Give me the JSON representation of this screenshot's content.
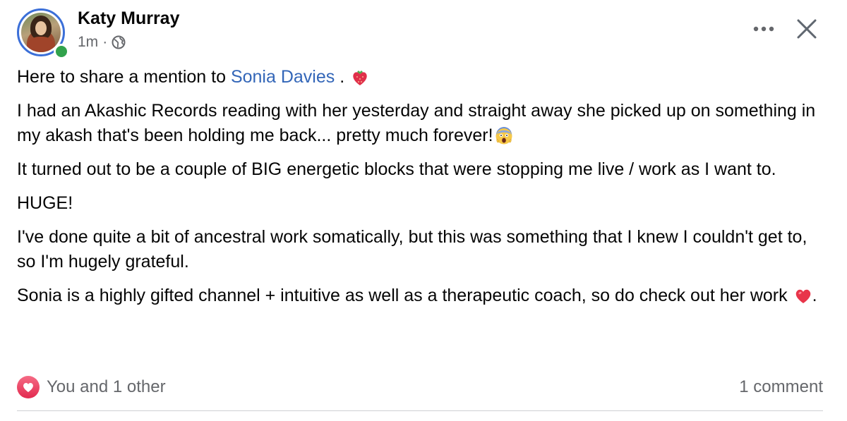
{
  "author": {
    "name": "Katy Murray",
    "time": "1m",
    "separator": "·",
    "status_color": "#31a24c"
  },
  "icons": {
    "globe": "globe-icon",
    "more": "more-options-icon",
    "close": "close-icon",
    "strawberry": "strawberry-heart-emoji",
    "scream": "face-screaming-emoji",
    "heart": "red-heart-emoji",
    "love": "love-reaction-icon"
  },
  "post": {
    "p1_before": "Here to share a mention to ",
    "p1_mention": "Sonia Davies",
    "p1_after": " . ",
    "p2": "I had an Akashic Records reading with her yesterday and straight away she picked up on something in my akash that's been holding me back... pretty much forever!",
    "p3": "It turned out to be a couple of BIG energetic blocks that were stopping me live / work as I want to.",
    "p4": "HUGE!",
    "p5": "I've done quite a bit of ancestral work somatically, but this was something that I knew I couldn't get to, so I'm hugely grateful.",
    "p6": "Sonia is a highly gifted channel + intuitive as well as a therapeutic coach, so do check out her work ",
    "p6_after": "."
  },
  "footer": {
    "reactions_label": "You and 1 other",
    "comments_label": "1 comment"
  },
  "colors": {
    "mention": "#3366b8",
    "secondary_text": "#65676b",
    "avatar_ring": "#3b6fd8",
    "love": "#e22a4f"
  }
}
